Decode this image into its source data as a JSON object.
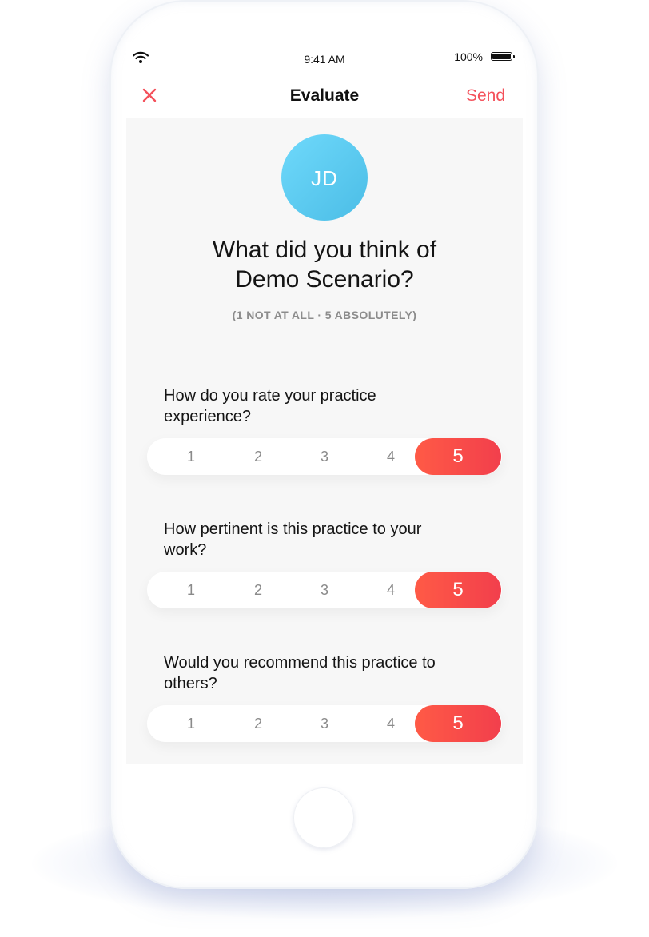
{
  "status_bar": {
    "time": "9:41 AM",
    "battery_percent": "100%",
    "icons": [
      "wifi-icon",
      "battery-icon"
    ]
  },
  "nav": {
    "title": "Evaluate",
    "close_icon": "close-icon",
    "send_label": "Send"
  },
  "colors": {
    "accent": "#f4505a",
    "avatar_gradient": [
      "#6fd9fb",
      "#4bbde6"
    ],
    "selected_gradient": [
      "#ff5a46",
      "#f23f4c"
    ],
    "screen_bg": "#f7f7f7"
  },
  "profile": {
    "initials": "JD"
  },
  "survey": {
    "title_line1": "What did you think of",
    "title_line2": "Demo Scenario?",
    "scale_hint": "(1 NOT AT ALL · 5 ABSOLUTELY)",
    "questions": [
      {
        "text": "How do you rate your practice experience?",
        "options": [
          "1",
          "2",
          "3",
          "4",
          "5"
        ],
        "selected": 5
      },
      {
        "text": "How pertinent is this practice to your work?",
        "options": [
          "1",
          "2",
          "3",
          "4",
          "5"
        ],
        "selected": 5
      },
      {
        "text": "Would you recommend this practice to others?",
        "options": [
          "1",
          "2",
          "3",
          "4",
          "5"
        ],
        "selected": 5
      }
    ]
  }
}
